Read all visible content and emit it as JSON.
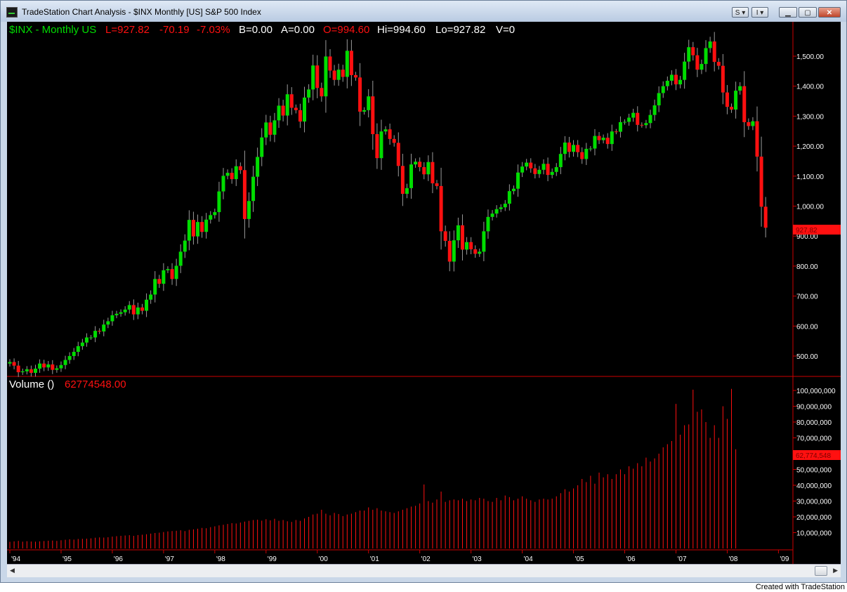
{
  "window": {
    "title": "TradeStation Chart Analysis - $INX  Monthly  [US] S&P 500 Index",
    "s_button": "S",
    "i_button": "I",
    "min_icon": "minimize-icon",
    "max_icon": "maximize-icon",
    "close_icon": "close-icon"
  },
  "price_header": {
    "symbol": "$INX - Monthly  US",
    "last": "L=927.82",
    "net_change": "-70.19",
    "pct_change": "-7.03%",
    "bid": "B=0.00",
    "ask": "A=0.00",
    "open": "O=994.60",
    "high": "Hi=994.60",
    "low": "Lo=927.82",
    "volume": "V=0"
  },
  "volume_header": {
    "label": "Volume ()",
    "value": "62774548.00"
  },
  "price_axis": {
    "ticks": [
      "1,500.00",
      "1,400.00",
      "1,300.00",
      "1,200.00",
      "1,100.00",
      "1,000.00",
      "900.00",
      "800.00",
      "700.00",
      "600.00",
      "500.00"
    ],
    "last_marker": "927.82"
  },
  "volume_axis": {
    "ticks": [
      "100,000,000",
      "90,000,000",
      "80,000,000",
      "70,000,000",
      "60,000,000",
      "50,000,000",
      "40,000,000",
      "30,000,000",
      "20,000,000",
      "10,000,000"
    ],
    "last_marker": "62,774,548"
  },
  "time_axis": {
    "ticks": [
      "'94",
      "'95",
      "'96",
      "'97",
      "'98",
      "'99",
      "'00",
      "'01",
      "'02",
      "'03",
      "'04",
      "'05",
      "'06",
      "'07",
      "'08",
      "'09"
    ]
  },
  "footer": "Created with TradeStation",
  "colors": {
    "up": "#00dd00",
    "down": "#ff1010",
    "volume": "#ff1010",
    "background": "#000000",
    "axis_text": "#ffffff"
  },
  "chart_data": {
    "type": "candlestick",
    "interval": "monthly",
    "x_start": "1994-01",
    "price_ylim": [
      430,
      1580
    ],
    "volume_ylim": [
      0,
      100000000
    ],
    "close": [
      480,
      468,
      446,
      449,
      456,
      444,
      458,
      475,
      462,
      472,
      454,
      459,
      470,
      487,
      500,
      514,
      533,
      545,
      562,
      562,
      584,
      582,
      605,
      616,
      636,
      641,
      646,
      655,
      670,
      639,
      662,
      651,
      688,
      705,
      757,
      741,
      786,
      790,
      757,
      801,
      848,
      885,
      954,
      899,
      947,
      914,
      955,
      970,
      980,
      1049,
      1101,
      1111,
      1090,
      1133,
      1120,
      957,
      1017,
      1098,
      1164,
      1229,
      1279,
      1238,
      1286,
      1335,
      1302,
      1373,
      1328,
      1320,
      1282,
      1362,
      1389,
      1469,
      1394,
      1366,
      1499,
      1452,
      1421,
      1455,
      1431,
      1518,
      1437,
      1429,
      1315,
      1320,
      1366,
      1240,
      1160,
      1249,
      1256,
      1224,
      1211,
      1134,
      1041,
      1060,
      1139,
      1148,
      1130,
      1106,
      1147,
      1076,
      1067,
      916,
      884,
      815,
      886,
      936,
      855,
      880,
      856,
      841,
      848,
      916,
      964,
      975,
      990,
      996,
      1008,
      1050,
      1058,
      1112,
      1132,
      1145,
      1126,
      1107,
      1121,
      1141,
      1104,
      1114,
      1130,
      1174,
      1212,
      1181,
      1204,
      1180,
      1157,
      1191,
      1192,
      1234,
      1220,
      1228,
      1207,
      1249,
      1248,
      1280,
      1281,
      1295,
      1311,
      1271,
      1270,
      1277,
      1304,
      1336,
      1377,
      1400,
      1418,
      1438,
      1406,
      1421,
      1482,
      1530,
      1503,
      1455,
      1474,
      1527,
      1549,
      1481,
      1468,
      1379,
      1331,
      1322,
      1385,
      1400,
      1280,
      1267,
      1283,
      1165,
      998,
      928
    ],
    "volume": [
      4.2,
      4.5,
      4.8,
      4.3,
      4.6,
      4.4,
      4.3,
      4.5,
      4.7,
      4.9,
      5.0,
      4.8,
      5.2,
      5.5,
      5.8,
      5.6,
      6.0,
      6.1,
      6.2,
      6.4,
      6.8,
      7.0,
      6.9,
      7.1,
      7.5,
      7.8,
      8.0,
      8.2,
      8.4,
      8.0,
      8.5,
      8.7,
      9.0,
      9.4,
      9.8,
      10.0,
      10.4,
      10.8,
      11.0,
      11.2,
      11.5,
      11.0,
      11.8,
      12.1,
      12.5,
      13.0,
      12.8,
      13.5,
      14.0,
      14.6,
      15.0,
      15.5,
      16.0,
      15.8,
      16.4,
      17.0,
      17.5,
      18.0,
      18.2,
      17.6,
      18.5,
      17.8,
      18.8,
      17.5,
      18.0,
      17.2,
      16.8,
      18.0,
      17.5,
      19.0,
      20.0,
      21.5,
      22.0,
      24.5,
      22.0,
      21.0,
      22.5,
      21.8,
      20.5,
      21.5,
      22.0,
      23.0,
      24.0,
      24.0,
      26.0,
      24.5,
      25.5,
      24.0,
      23.5,
      23.0,
      22.5,
      23.5,
      24.5,
      25.5,
      26.5,
      27.0,
      28.5,
      40.5,
      30.0,
      29.0,
      31.0,
      36.0,
      29.5,
      30.5,
      31.0,
      30.5,
      31.5,
      30.0,
      31.0,
      30.5,
      32.0,
      31.5,
      30.0,
      29.5,
      32.0,
      30.5,
      33.5,
      32.5,
      30.5,
      31.5,
      33.0,
      31.5,
      30.5,
      29.5,
      31.0,
      31.5,
      31.0,
      31.5,
      33.0,
      35.0,
      37.5,
      36.0,
      38.0,
      40.0,
      44.0,
      42.0,
      46.0,
      41.0,
      48.0,
      45.0,
      47.0,
      44.0,
      47.0,
      50.0,
      47.0,
      52.0,
      50.5,
      54.0,
      52.0,
      57.5,
      55.0,
      57.0,
      60.0,
      64.0,
      66.0,
      68.0,
      91.5,
      72.0,
      78.0,
      78.5,
      100.5,
      86.5,
      88.0,
      80.0,
      70.0,
      78.0,
      70.0,
      90.0,
      82.0,
      101.0,
      62.8
    ]
  }
}
